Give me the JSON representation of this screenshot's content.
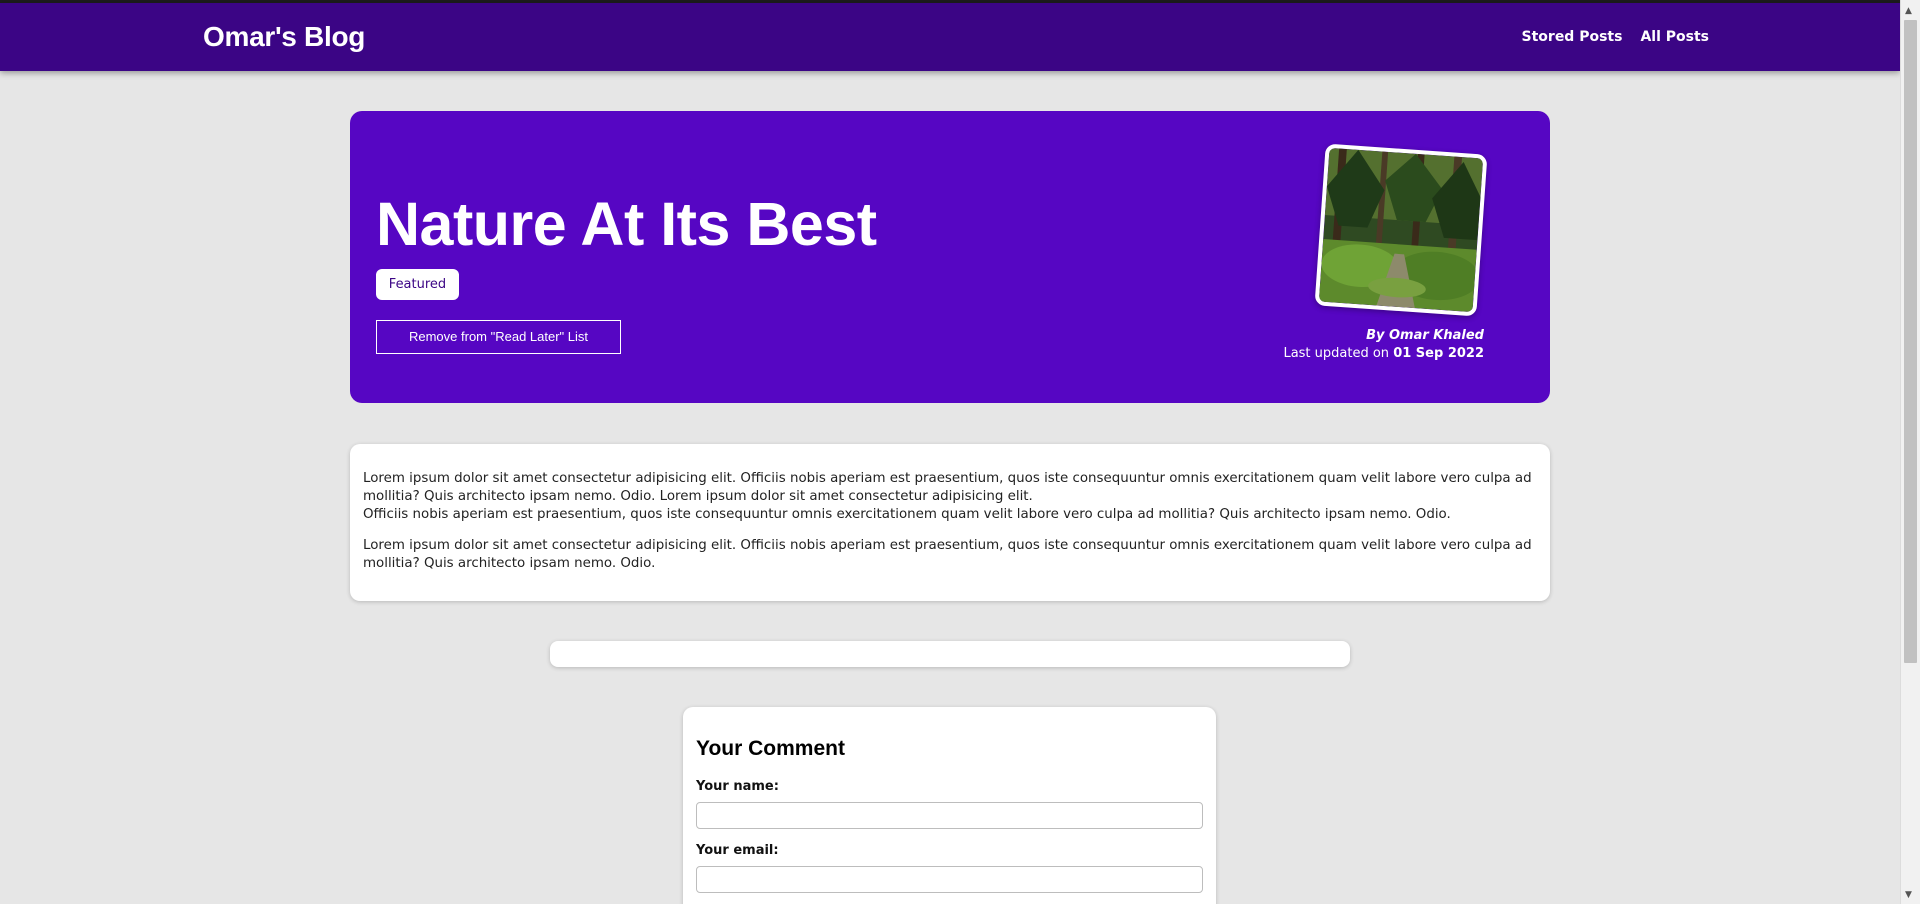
{
  "header": {
    "brand": "Omar's Blog",
    "nav": [
      "Stored Posts",
      "All Posts"
    ]
  },
  "post": {
    "title": "Nature At Its Best",
    "badge": "Featured",
    "read_later_button": "Remove from \"Read Later\" List",
    "author": "By Omar Khaled",
    "updated_prefix": "Last updated on",
    "updated_date": "01 Sep 2022",
    "image_icon": "forest-photo"
  },
  "content": {
    "paragraph1_line1": "Lorem ipsum dolor sit amet consectetur adipisicing elit. Officiis nobis aperiam est praesentium, quos iste consequuntur omnis exercitationem quam velit labore vero culpa ad mollitia? Quis architecto ipsam nemo. Odio. Lorem ipsum dolor sit amet consectetur adipisicing elit.",
    "paragraph1_line2": "Officiis nobis aperiam est praesentium, quos iste consequuntur omnis exercitationem quam velit labore vero culpa ad mollitia? Quis architecto ipsam nemo. Odio.",
    "paragraph2": "Lorem ipsum dolor sit amet consectetur adipisicing elit. Officiis nobis aperiam est praesentium, quos iste consequuntur omnis exercitationem quam velit labore vero culpa ad mollitia? Quis architecto ipsam nemo. Odio."
  },
  "comment_form": {
    "title": "Your Comment",
    "name_label": "Your name:",
    "email_label": "Your email:",
    "name_value": "",
    "email_value": ""
  },
  "colors": {
    "header_bg": "#3b0585",
    "hero_bg": "#5606c3",
    "page_bg": "#e6e6e6"
  }
}
